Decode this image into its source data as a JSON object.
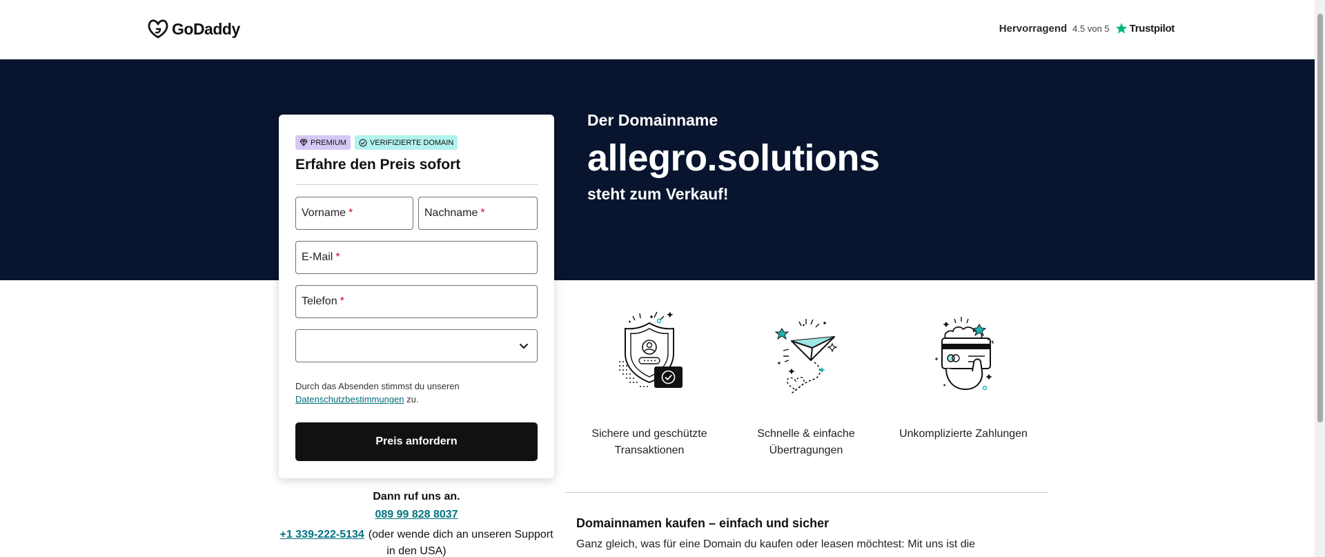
{
  "header": {
    "brand": "GoDaddy",
    "rating_label": "Hervorragend",
    "rating_score": "4.5 von 5",
    "rating_source": "Trustpilot"
  },
  "hero": {
    "intro": "Der Domainname",
    "domain": "allegro.solutions",
    "status": "steht zum Verkauf!",
    "background_color": "#09152e"
  },
  "form": {
    "badges": [
      "PREMIUM",
      "VERIFIZIERTE DOMAIN"
    ],
    "title": "Erfahre den Preis sofort",
    "fields": {
      "first_name": "Vorname",
      "last_name": "Nachname",
      "email": "E-Mail",
      "phone": "Telefon"
    },
    "required_marker": "*",
    "consent_text": "Durch das Absenden stimmst du unseren",
    "consent_link": "Datenschutzbestimmungen",
    "consent_suffix": "zu.",
    "submit_label": "Preis anfordern"
  },
  "call": {
    "heading": "Dann ruf uns an.",
    "phone_local": "089 99 828 8037",
    "phone_us": "+1 339-222-5134",
    "phone_us_note": "(oder wende dich an unseren Support in den USA)"
  },
  "features": [
    {
      "label": "Sichere und geschützte Transaktionen",
      "icon": "secure-shield-icon"
    },
    {
      "label": "Schnelle & einfache Übertragungen",
      "icon": "paper-plane-icon"
    },
    {
      "label": "Unkomplizierte Zahlungen",
      "icon": "payment-card-icon"
    }
  ],
  "info": {
    "title": "Domainnamen kaufen – einfach und sicher",
    "text": "Ganz gleich, was für eine Domain du kaufen oder leasen möchtest: Mit uns ist die"
  },
  "colors": {
    "accent_teal": "#00737f",
    "button": "#111111",
    "required": "#d0021b",
    "trustpilot_star": "#00b67a"
  }
}
